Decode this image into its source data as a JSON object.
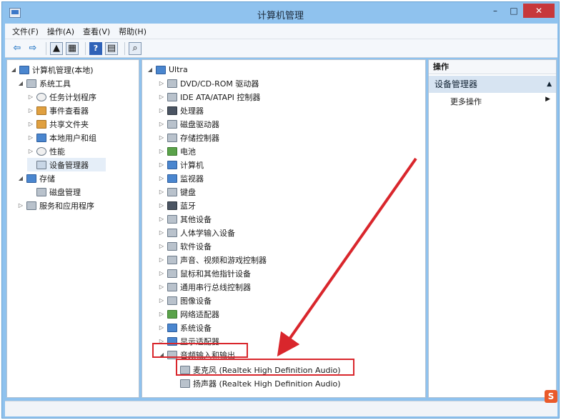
{
  "window": {
    "title": "计算机管理",
    "controls": {
      "minimize": "–",
      "maximize": "□",
      "close": "✕"
    }
  },
  "menubar": {
    "items": [
      "文件(F)",
      "操作(A)",
      "查看(V)",
      "帮助(H)"
    ]
  },
  "left_tree": {
    "items": [
      {
        "label": "计算机管理(本地)",
        "level": 0,
        "icon": "computer-management-icon",
        "expanded": true
      },
      {
        "label": "系统工具",
        "level": 1,
        "icon": "system-tools-icon",
        "expanded": true
      },
      {
        "label": "任务计划程序",
        "level": 2,
        "icon": "clock-icon",
        "expanded": false
      },
      {
        "label": "事件查看器",
        "level": 2,
        "icon": "event-viewer-icon",
        "expanded": false
      },
      {
        "label": "共享文件夹",
        "level": 2,
        "icon": "shared-folder-icon",
        "expanded": false
      },
      {
        "label": "本地用户和组",
        "level": 2,
        "icon": "users-icon",
        "expanded": false
      },
      {
        "label": "性能",
        "level": 2,
        "icon": "performance-icon",
        "expanded": false
      },
      {
        "label": "设备管理器",
        "level": 2,
        "icon": "device-manager-icon",
        "selected": true
      },
      {
        "label": "存储",
        "level": 1,
        "icon": "storage-icon",
        "expanded": true
      },
      {
        "label": "磁盘管理",
        "level": 2,
        "icon": "disk-management-icon"
      },
      {
        "label": "服务和应用程序",
        "level": 1,
        "icon": "services-icon",
        "expanded": false
      }
    ]
  },
  "device_tree": {
    "root": "Ultra",
    "categories": [
      {
        "label": "DVD/CD-ROM 驱动器",
        "icon": "dvd-drive-icon"
      },
      {
        "label": "IDE ATA/ATAPI 控制器",
        "icon": "ide-controller-icon"
      },
      {
        "label": "处理器",
        "icon": "processor-icon"
      },
      {
        "label": "磁盘驱动器",
        "icon": "disk-drive-icon"
      },
      {
        "label": "存储控制器",
        "icon": "storage-controller-icon"
      },
      {
        "label": "电池",
        "icon": "battery-icon"
      },
      {
        "label": "计算机",
        "icon": "computer-icon"
      },
      {
        "label": "监视器",
        "icon": "monitor-icon"
      },
      {
        "label": "键盘",
        "icon": "keyboard-icon"
      },
      {
        "label": "蓝牙",
        "icon": "bluetooth-icon"
      },
      {
        "label": "其他设备",
        "icon": "other-devices-icon"
      },
      {
        "label": "人体学输入设备",
        "icon": "hid-icon"
      },
      {
        "label": "软件设备",
        "icon": "software-device-icon"
      },
      {
        "label": "声音、视频和游戏控制器",
        "icon": "sound-icon"
      },
      {
        "label": "鼠标和其他指针设备",
        "icon": "mouse-icon"
      },
      {
        "label": "通用串行总线控制器",
        "icon": "usb-icon"
      },
      {
        "label": "图像设备",
        "icon": "imaging-icon"
      },
      {
        "label": "网络适配器",
        "icon": "network-adapter-icon"
      },
      {
        "label": "系统设备",
        "icon": "system-devices-icon"
      },
      {
        "label": "显示适配器",
        "icon": "display-adapter-icon"
      },
      {
        "label": "音频输入和输出",
        "icon": "audio-io-icon",
        "expanded": true
      }
    ],
    "audio_children": [
      {
        "label": "麦克风 (Realtek High Definition Audio)",
        "icon": "microphone-icon"
      },
      {
        "label": "扬声器 (Realtek High Definition Audio)",
        "icon": "speaker-icon"
      }
    ]
  },
  "actions_pane": {
    "header": "操作",
    "section": "设备管理器",
    "more_actions": "更多操作"
  },
  "colors": {
    "titlebar": "#8fc2ee",
    "close_button": "#c7383b",
    "annotation_red": "#d9262c",
    "section_bg": "#d7e4f2"
  }
}
